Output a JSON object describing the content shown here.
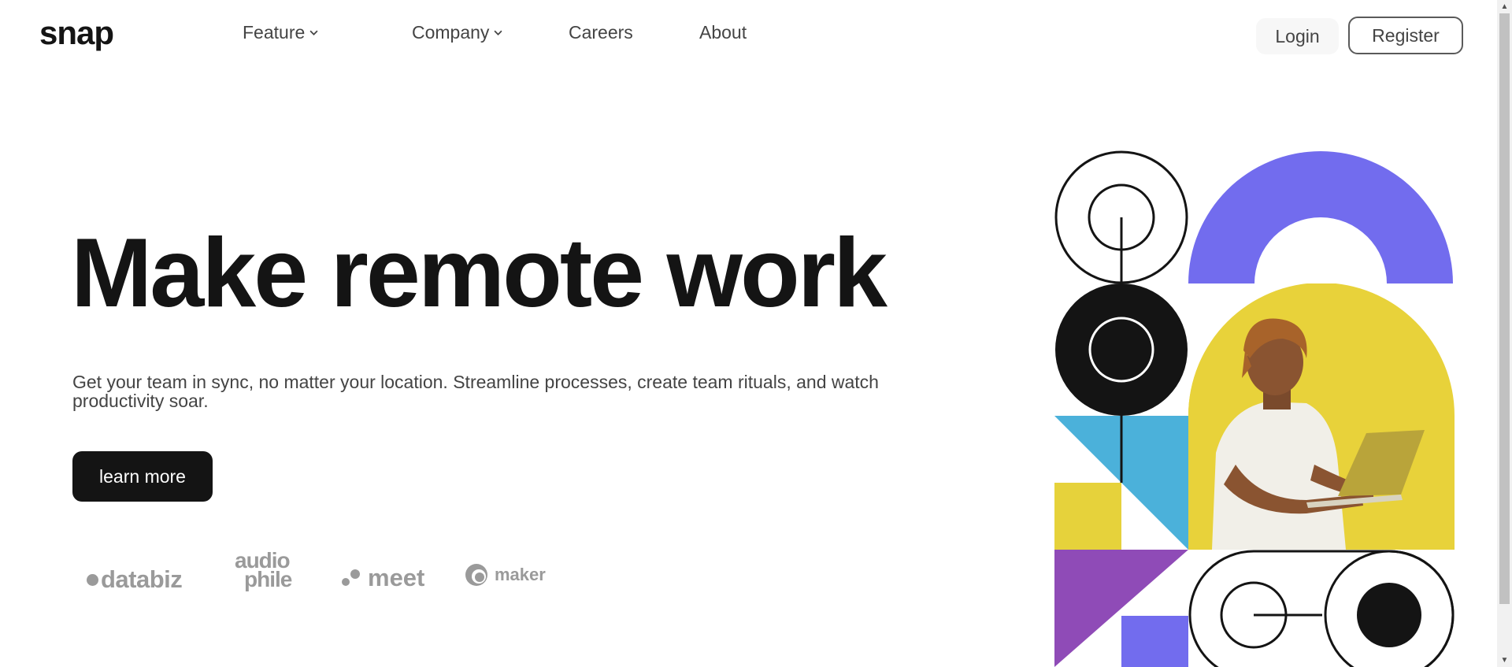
{
  "header": {
    "logo": "snap",
    "nav": [
      {
        "label": "Feature",
        "has_dropdown": true
      },
      {
        "label": "Company",
        "has_dropdown": true
      },
      {
        "label": "Careers",
        "has_dropdown": false
      },
      {
        "label": "About",
        "has_dropdown": false
      }
    ],
    "login_label": "Login",
    "register_label": "Register"
  },
  "hero": {
    "title": "Make remote work",
    "subtitle": "Get your team in sync, no matter your location. Streamline processes, create team rituals, and watch productivity soar.",
    "cta_label": "learn more"
  },
  "clients": {
    "databiz": "databiz",
    "audiophile_line1": "audio",
    "audiophile_line2": "phile",
    "meet": "meet",
    "maker": "maker"
  },
  "colors": {
    "text_dark": "#141414",
    "text_medium": "#444444",
    "logo_gray": "#9a9a9a",
    "art_purple": "#726cee",
    "art_yellow": "#e6d23b",
    "art_blue": "#4bb1da",
    "art_violet": "#8f4bb7",
    "art_black": "#141414"
  }
}
